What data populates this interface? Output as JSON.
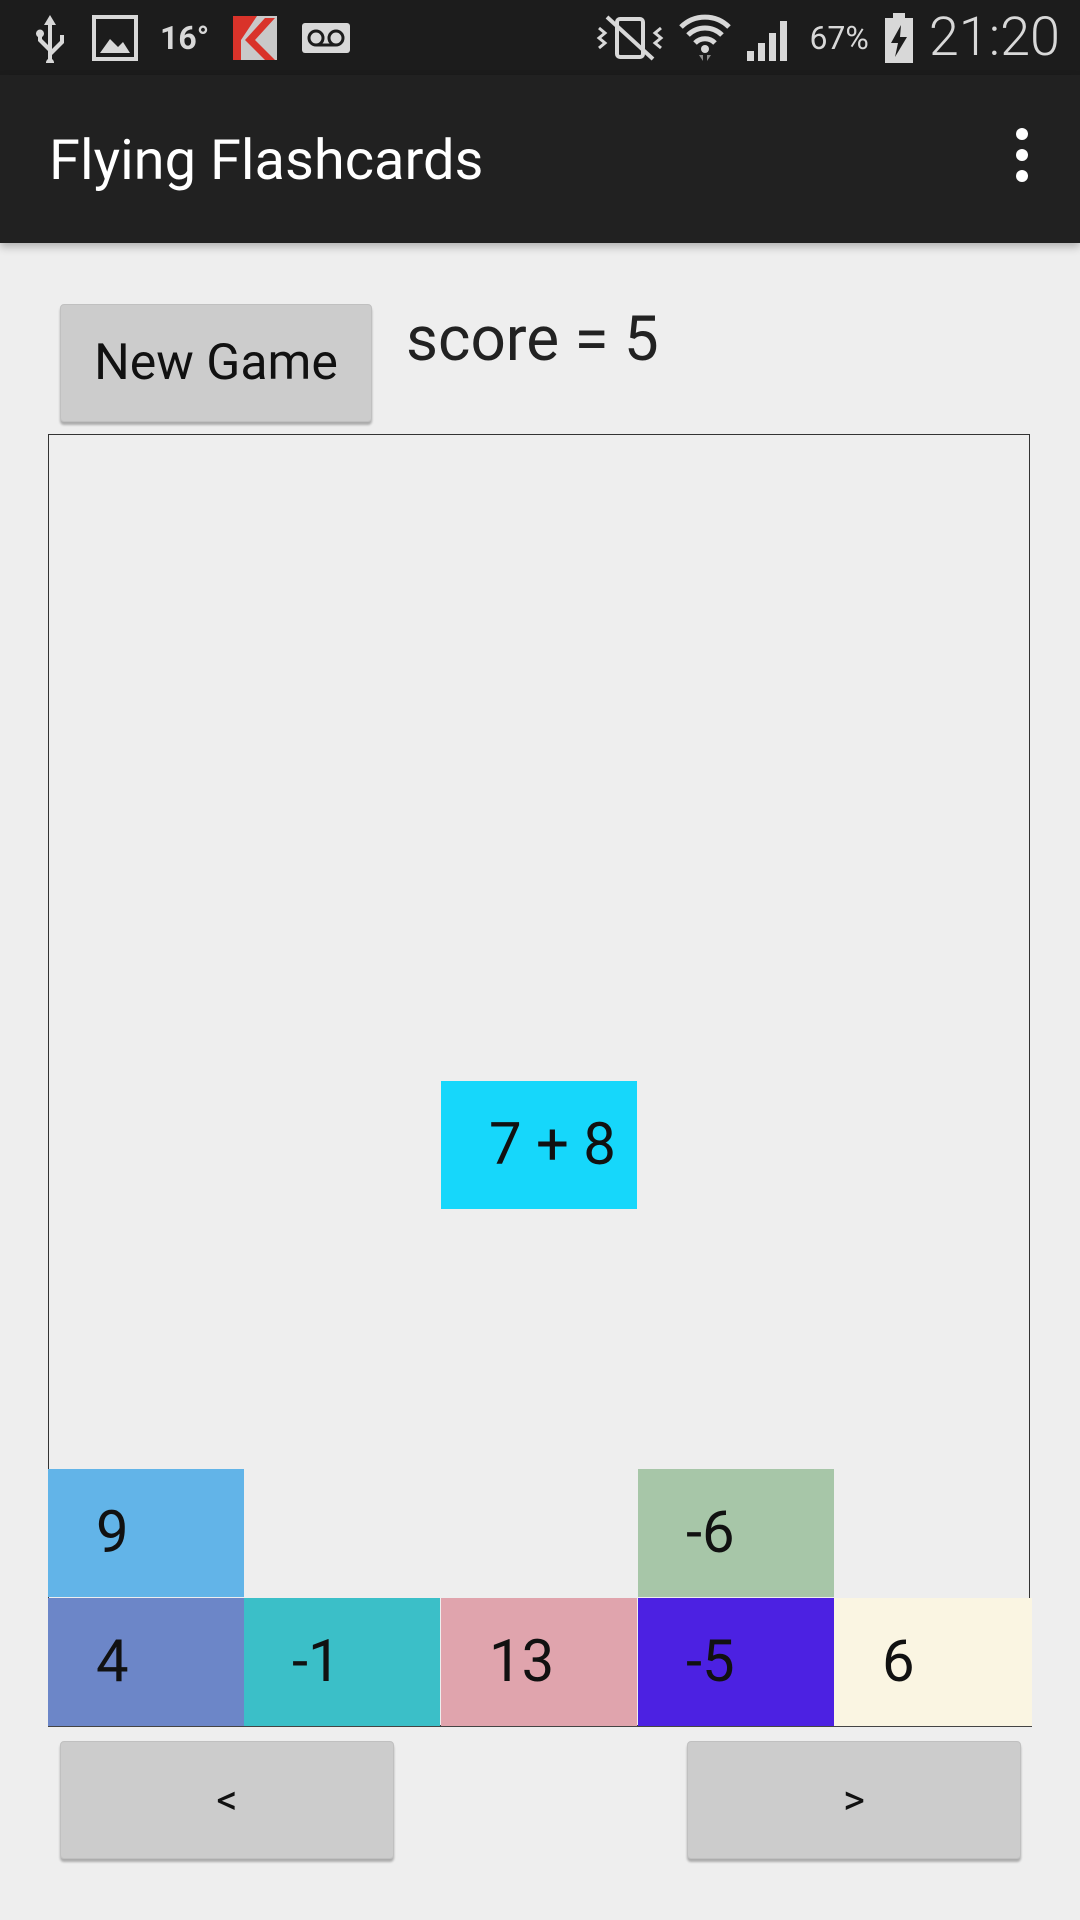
{
  "status_bar": {
    "temperature": "16°",
    "battery_percent": "67%",
    "time": "21:20",
    "icons": [
      "usb-icon",
      "image-icon",
      "kaspersky-icon",
      "voicemail-icon",
      "vibrate-icon",
      "wifi-icon",
      "signal-icon",
      "battery-charging-icon"
    ]
  },
  "app_bar": {
    "title": "Flying Flashcards",
    "menu_icon": "overflow-menu-icon"
  },
  "controls": {
    "new_game_label": "New Game",
    "score_text": "score = 5",
    "prev_label": "<",
    "next_label": ">"
  },
  "game": {
    "falling_card": {
      "text": "7 + 8",
      "color": "#16d7fb"
    },
    "answer_stacks": [
      {
        "text": "9",
        "color": "#62b4e8",
        "column": 1,
        "row": 2
      },
      {
        "text": "-6",
        "color": "#a7c6a8",
        "column": 4,
        "row": 2
      },
      {
        "text": "4",
        "color": "#6c86c8",
        "column": 1,
        "row": 1
      },
      {
        "text": "-1",
        "color": "#3bbfc8",
        "column": 2,
        "row": 1
      },
      {
        "text": "13",
        "color": "#e0a4ad",
        "column": 3,
        "row": 1
      },
      {
        "text": "-5",
        "color": "#4c21e2",
        "column": 4,
        "row": 1
      },
      {
        "text": "6",
        "color": "#faf5e2",
        "column": 5,
        "row": 1
      }
    ]
  }
}
